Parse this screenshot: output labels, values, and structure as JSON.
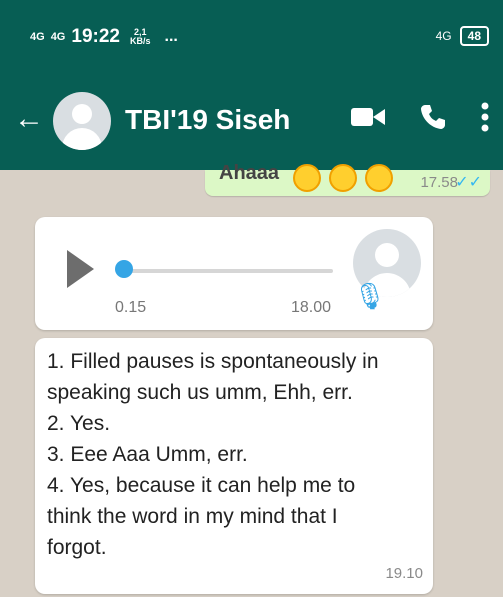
{
  "status_bar": {
    "network1": "4G",
    "network2": "4G",
    "time": "19:22",
    "speed_value": "2,1",
    "speed_unit": "KB/s",
    "dots": "...",
    "right_network": "4G",
    "battery": "48"
  },
  "header": {
    "title": "TBI'19 Siseh",
    "back_icon": "arrow-left-icon",
    "video_icon": "video-call-icon",
    "call_icon": "phone-icon",
    "menu_icon": "more-vertical-icon"
  },
  "messages": {
    "outgoing_partial": {
      "text": "Ahaaa",
      "time": "17.58",
      "ticks_icon": "double-check-icon"
    },
    "voice_note": {
      "current": "0.15",
      "duration": "18.00",
      "progress_fraction": 0.0,
      "play_icon": "play-icon",
      "mic_icon": "microphone-icon"
    },
    "text_message": {
      "lines": [
        "1. Filled pauses is spontaneously in",
        "speaking such us umm, Ehh, err.",
        "2. Yes.",
        "3. Eee Aaa Umm, err.",
        "4. Yes, because it can help me to",
        "think the word in my mind that I",
        "forgot."
      ],
      "time": "19.10"
    }
  },
  "colors": {
    "header": "#075e54",
    "outgoing_bubble": "#dcf8c6",
    "incoming_bubble": "#ffffff",
    "accent": "#35a5e5",
    "chat_background": "#d8d0c6"
  }
}
